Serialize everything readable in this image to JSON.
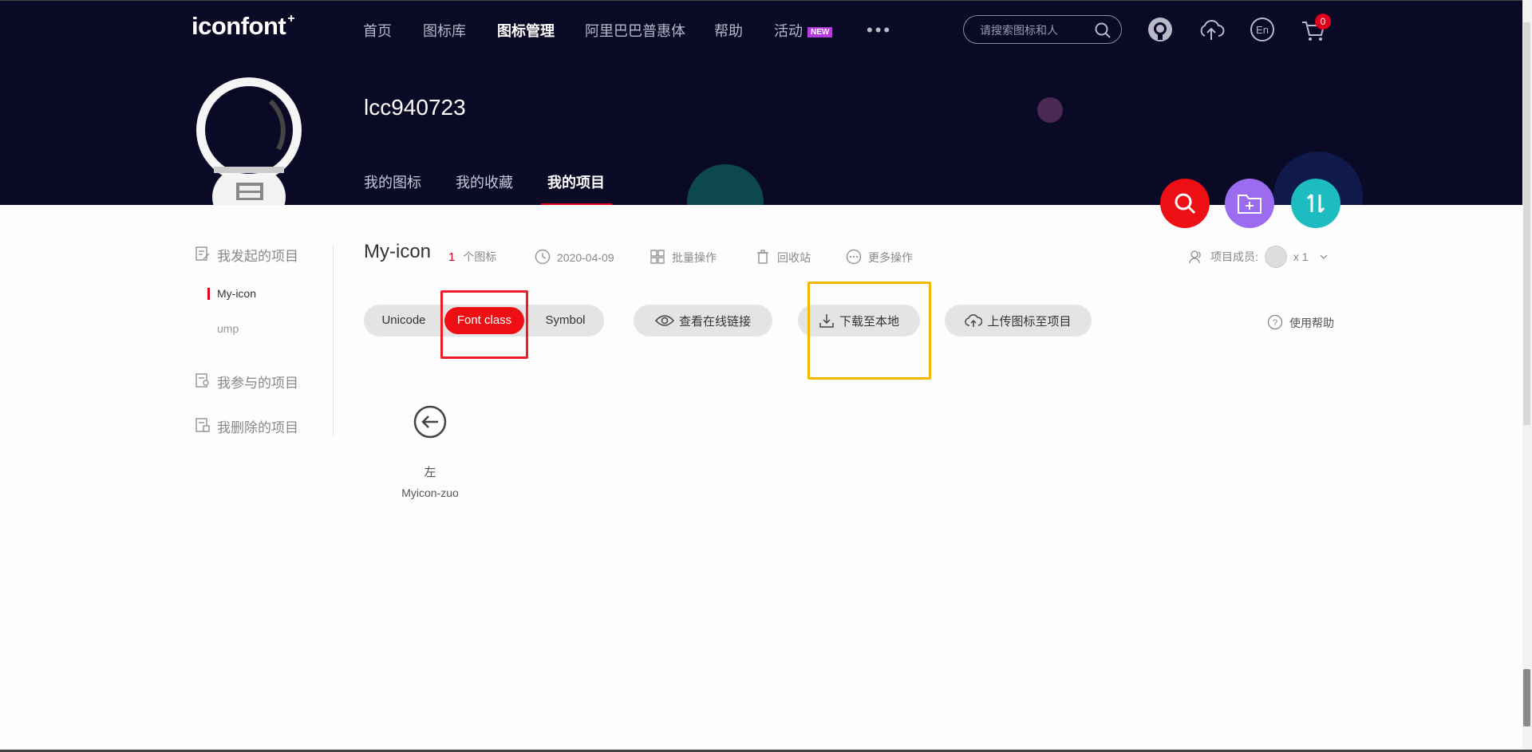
{
  "brand": {
    "logo": "iconfont",
    "logo_sup": "+"
  },
  "nav": {
    "items": [
      {
        "label": "首页"
      },
      {
        "label": "图标库"
      },
      {
        "label": "图标管理"
      },
      {
        "label": "阿里巴巴普惠体"
      },
      {
        "label": "帮助"
      },
      {
        "label": "活动"
      }
    ],
    "activity_badge": "NEW",
    "more": "•••"
  },
  "search": {
    "placeholder": "请搜索图标和人"
  },
  "cart": {
    "count": "0"
  },
  "profile": {
    "username": "lcc940723",
    "tabs": [
      {
        "label": "我的图标"
      },
      {
        "label": "我的收藏"
      },
      {
        "label": "我的项目"
      }
    ]
  },
  "sidebar": {
    "sections": [
      {
        "label": "我发起的项目"
      },
      {
        "label": "我参与的项目"
      },
      {
        "label": "我删除的项目"
      }
    ],
    "projects": [
      {
        "label": "My-icon"
      },
      {
        "label": "ump"
      }
    ]
  },
  "project": {
    "title": "My-icon",
    "icon_count": "1",
    "icon_count_unit": "个图标",
    "date": "2020-04-09",
    "batch": "批量操作",
    "recycle": "回收站",
    "more_ops": "更多操作",
    "members_label": "项目成员:",
    "members_count": "x 1"
  },
  "toolbar": {
    "modes": [
      {
        "label": "Unicode"
      },
      {
        "label": "Font class"
      },
      {
        "label": "Symbol"
      }
    ],
    "view_link": "查看在线链接",
    "download": "下载至本地",
    "upload": "上传图标至项目",
    "help": "使用帮助"
  },
  "icons": [
    {
      "name": "左",
      "code": "Myicon-zuo"
    }
  ],
  "colors": {
    "header_bg": "#0a0926",
    "accent_red": "#ee0f15",
    "purple": "#9b6cf0",
    "teal": "#1dbcc0",
    "highlight_red": "#ee1c25",
    "highlight_yellow": "#f5b800"
  }
}
